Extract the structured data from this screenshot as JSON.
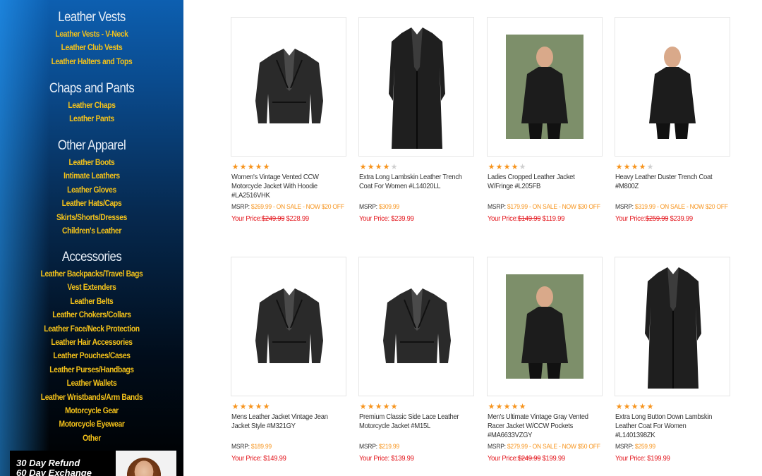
{
  "sidebar": {
    "sections": [
      {
        "heading": "Leather Vests",
        "links": [
          "Leather Vests - V-Neck",
          "Leather Club Vests",
          "Leather Halters and Tops"
        ]
      },
      {
        "heading": "Chaps and Pants",
        "links": [
          "Leather Chaps",
          "Leather Pants"
        ]
      },
      {
        "heading": "Other Apparel",
        "links": [
          "Leather Boots",
          "Intimate Leathers",
          "Leather Gloves",
          "Leather Hats/Caps",
          "Skirts/Shorts/Dresses",
          "Children's Leather"
        ]
      },
      {
        "heading": "Accessories",
        "links": [
          "Leather Backpacks/Travel Bags",
          "Vest Extenders",
          "Leather Belts",
          "Leather Chokers/Collars",
          "Leather Face/Neck Protection",
          "Leather Hair Accessories",
          "Leather Pouches/Cases",
          "Leather Purses/Handbags",
          "Leather Wallets",
          "Leather Wristbands/Arm Bands",
          "Motorcycle Gear",
          "Motorcycle Eyewear",
          "Other"
        ]
      }
    ],
    "promo": {
      "line1": "30 Day Refund",
      "line2": "60 Day Exchange"
    }
  },
  "colors": {
    "star": "#f7941d",
    "msrp": "#f7941d",
    "price": "#e3141b",
    "link": "#f4c21a"
  },
  "products": [
    {
      "name": "Women's Vintage Vented CCW Motorcycle Jacket With Hoodie #LA2516VHK",
      "rating": 5,
      "msrp_label": "MSRP:",
      "msrp": "$269.99",
      "sale_note": "- ON SALE - NOW $20 OFF",
      "price_label": "Your Price:",
      "old_price": "$249.99",
      "price": "$228.99",
      "image": "jacket-icon"
    },
    {
      "name": "Extra Long Lambskin Leather Trench Coat For Women #L14020LL",
      "rating": 4,
      "msrp_label": "MSRP:",
      "msrp": "$309.99",
      "sale_note": "",
      "price_label": "Your Price:",
      "old_price": "",
      "price": "$239.99",
      "image": "trench-coat-icon"
    },
    {
      "name": "Ladies Cropped Leather Jacket W/Fringe #L205FB",
      "rating": 4,
      "msrp_label": "MSRP:",
      "msrp": "$179.99",
      "sale_note": "- ON SALE - NOW $30 OFF",
      "price_label": "Your Price:",
      "old_price": "$149.99",
      "price": "$119.99",
      "image": "model-photo"
    },
    {
      "name": "Heavy Leather Duster Trench Coat #M800Z",
      "rating": 4,
      "msrp_label": "MSRP:",
      "msrp": "$319.99",
      "sale_note": "- ON SALE - NOW $20 OFF",
      "price_label": "Your Price:",
      "old_price": "$259.99",
      "price": "$239.99",
      "image": "model-photo"
    },
    {
      "name": "Mens Leather Jacket Vintage Jean Jacket Style #M321GY",
      "rating": 5,
      "msrp_label": "MSRP:",
      "msrp": "$189.99",
      "sale_note": "",
      "price_label": "Your Price:",
      "old_price": "",
      "price": "$149.99",
      "image": "jacket-icon"
    },
    {
      "name": "Premium Classic Side Lace Leather Motorcycle Jacket #M15L",
      "rating": 5,
      "msrp_label": "MSRP:",
      "msrp": "$219.99",
      "sale_note": "",
      "price_label": "Your Price:",
      "old_price": "",
      "price": "$139.99",
      "image": "jacket-icon"
    },
    {
      "name": "Men's Ultimate Vintage Gray Vented Racer Jacket W/CCW Pockets #MA6633VZGY",
      "rating": 5,
      "msrp_label": "MSRP:",
      "msrp": "$279.99",
      "sale_note": "- ON SALE - NOW $50 OFF",
      "price_label": "Your Price:",
      "old_price": "$249.99",
      "price": "$199.99",
      "image": "model-photo"
    },
    {
      "name": "Extra Long Button Down Lambskin Leather Coat For Women #L1401398ZK",
      "rating": 5,
      "msrp_label": "MSRP:",
      "msrp": "$259.99",
      "sale_note": "",
      "price_label": "Your Price:",
      "old_price": "",
      "price": "$199.99",
      "image": "trench-coat-icon"
    }
  ]
}
